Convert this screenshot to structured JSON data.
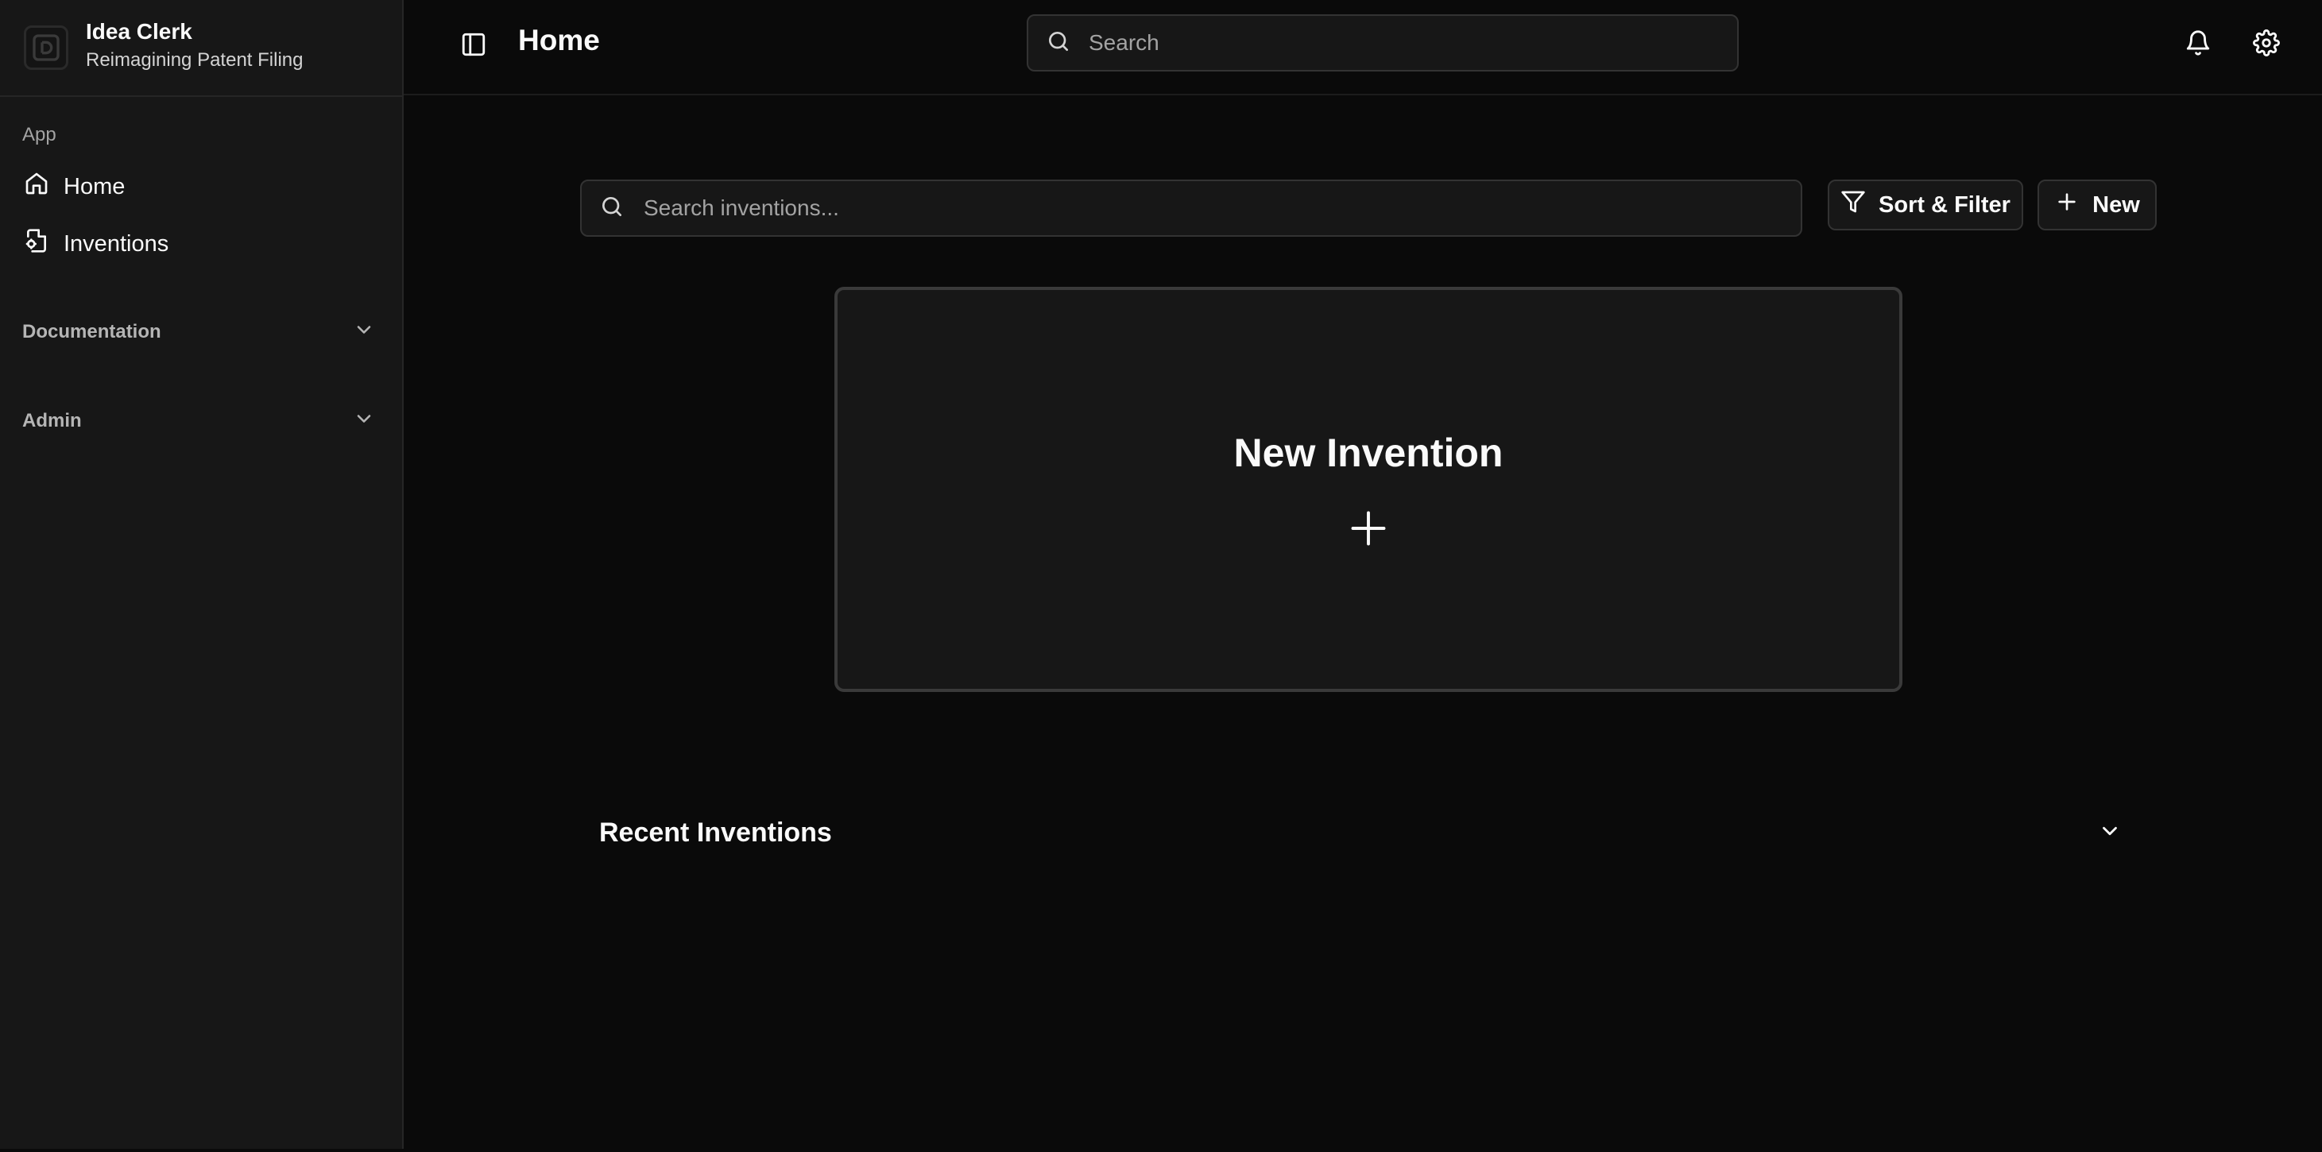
{
  "brand": {
    "name": "Idea Clerk",
    "tagline": "Reimagining Patent Filing",
    "logo_icon": "logo-icon"
  },
  "sidebar": {
    "group_label": "App",
    "items": [
      {
        "label": "Home",
        "icon": "home-icon"
      },
      {
        "label": "Inventions",
        "icon": "document-icon"
      }
    ],
    "sections": [
      {
        "label": "Documentation",
        "icon": "chevron-down-icon"
      },
      {
        "label": "Admin",
        "icon": "chevron-down-icon"
      }
    ]
  },
  "header": {
    "title": "Home",
    "search_placeholder": "Search",
    "toggle_icon": "sidebar-toggle-icon",
    "notification_icon": "bell-icon",
    "settings_icon": "gear-icon"
  },
  "main": {
    "search_placeholder": "Search inventions...",
    "sort_filter_label": "Sort & Filter",
    "new_label": "New",
    "new_card_title": "New Invention",
    "recent_title": "Recent Inventions"
  },
  "colors": {
    "background": "#0a0a0a",
    "sidebar": "#171717",
    "border": "#333333",
    "text": "#fafafa",
    "muted": "#a3a3a3"
  }
}
